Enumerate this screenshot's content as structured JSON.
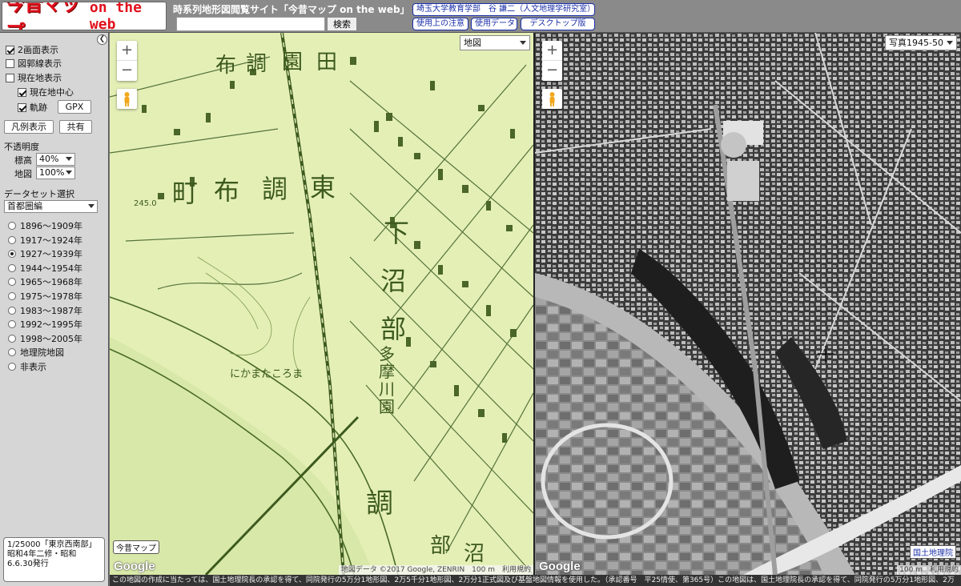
{
  "header": {
    "logo_jp": "今昔マップ",
    "logo_en": "on the web",
    "site_title": "時系列地形図閲覧サイト「今昔マップ on the web」",
    "search_placeholder": "",
    "search_button": "検索",
    "author_link": "埼玉大学教育学部　谷 謙二（人文地理学研究室）",
    "notes_link": "使用上の注意",
    "data_link": "使用データ",
    "desktop_link": "デスクトップ版"
  },
  "sidebar": {
    "options": [
      {
        "label": "2画面表示",
        "checked": true
      },
      {
        "label": "図郭線表示",
        "checked": false
      },
      {
        "label": "現在地表示",
        "checked": false
      }
    ],
    "sub_options": [
      {
        "label": "現在地中心",
        "checked": true
      },
      {
        "label": "軌跡",
        "checked": true
      }
    ],
    "gpx_button": "GPX",
    "legend_button": "凡例表示",
    "share_button": "共有",
    "opacity_heading": "不透明度",
    "opacity_elev_label": "標高",
    "opacity_elev_value": "40%",
    "opacity_map_label": "地図",
    "opacity_map_value": "100%",
    "dataset_heading": "データセット選択",
    "dataset_value": "首都圏編",
    "periods": [
      {
        "label": "1896～1909年",
        "selected": false
      },
      {
        "label": "1917～1924年",
        "selected": false
      },
      {
        "label": "1927～1939年",
        "selected": true
      },
      {
        "label": "1944～1954年",
        "selected": false
      },
      {
        "label": "1965～1968年",
        "selected": false
      },
      {
        "label": "1975～1978年",
        "selected": false
      },
      {
        "label": "1983～1987年",
        "selected": false
      },
      {
        "label": "1992～1995年",
        "selected": false
      },
      {
        "label": "1998～2005年",
        "selected": false
      },
      {
        "label": "地理院地図",
        "selected": false
      },
      {
        "label": "非表示",
        "selected": false
      }
    ],
    "map_info": "1/25000「東京西南部」 昭和4年二修・昭和6.6.30発行"
  },
  "map_left": {
    "type_value": "地図",
    "badge": "今昔マップ",
    "attribution": "地図データ ©2017 Google, ZENRIN　100 m　利用規約",
    "google": "Google",
    "labels": [
      "布",
      "調",
      "園",
      "田",
      "町",
      "布",
      "調",
      "東",
      "下",
      "沼",
      "部",
      "多摩川園",
      "調",
      "部",
      "沼",
      "245.0",
      "にかまたころま"
    ]
  },
  "map_right": {
    "type_value": "写真1945-50",
    "gsi_badge": "国土地理院",
    "attribution": "100 m　利用規約",
    "google": "Google"
  },
  "footer_text": "この地図の作成に当たっては、国土地理院長の承認を得て、同院発行の5万分1地形図、2万5千分1地形図、2万分1正式図及び基盤地図情報を使用した。（承認番号　平25情使、第365号）この地図は、国土地理院長の承認を得て、同院発行の5万分1地形図、2万",
  "colors": {
    "logo_red": "#e0101c",
    "link_blue": "#1a2fa8",
    "old_map_bg": "#e3efb4",
    "old_map_ink": "#3d5a1e"
  }
}
